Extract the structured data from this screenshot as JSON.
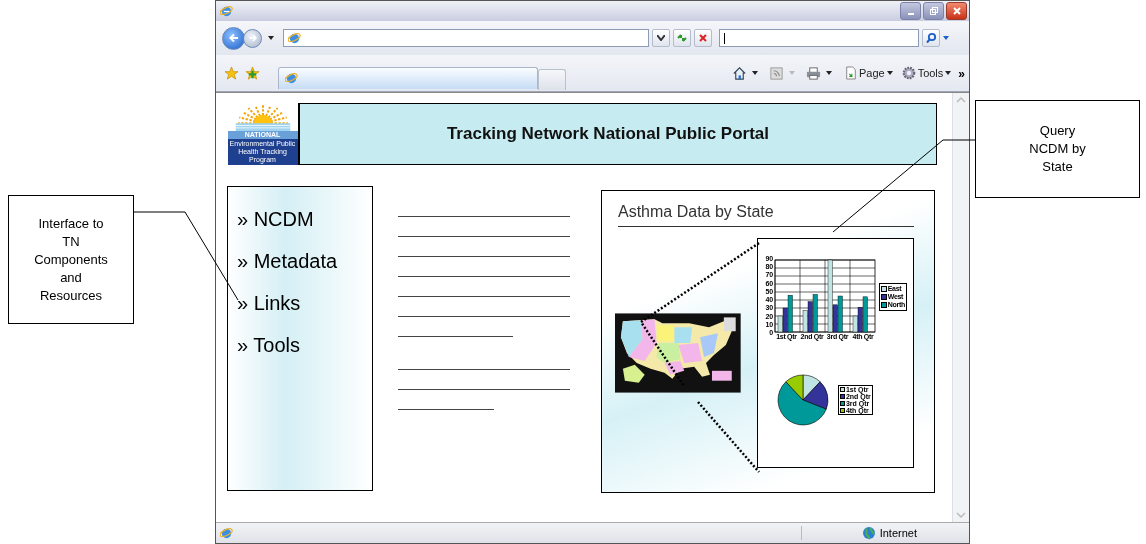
{
  "toolbar": {
    "page_menu": "Page",
    "tools_menu": "Tools",
    "chevron": "»"
  },
  "portal": {
    "logo_word": "NATIONAL",
    "logo_caption": "Environmental Public Health Tracking Program",
    "title": "Tracking Network National Public Portal",
    "nav": [
      {
        "label": "» NCDM"
      },
      {
        "label": "» Metadata"
      },
      {
        "label": "» Links"
      },
      {
        "label": "» Tools"
      }
    ],
    "panel": {
      "title": "Asthma Data by State",
      "chart_data": {
        "type": "bar",
        "categories": [
          "1st Qtr",
          "2nd Qtr",
          "3rd Qtr",
          "4th Qtr"
        ],
        "series": [
          {
            "name": "East",
            "color": "#c0e4e4",
            "values": [
              20,
              27,
              90,
              20
            ]
          },
          {
            "name": "West",
            "color": "#333399",
            "values": [
              30,
              38,
              34,
              31
            ]
          },
          {
            "name": "North",
            "color": "#009999",
            "values": [
              46,
              47,
              45,
              44
            ]
          }
        ],
        "ylim": [
          0,
          90
        ],
        "grid": true,
        "legend": "right",
        "yticks": [
          0,
          10,
          20,
          30,
          40,
          50,
          60,
          70,
          80,
          90
        ]
      },
      "pie_legend": [
        {
          "label": "1st Qtr",
          "color": "#c0e4e4"
        },
        {
          "label": "2nd Qtr",
          "color": "#333399"
        },
        {
          "label": "3rd Qtr",
          "color": "#009999"
        },
        {
          "label": "4th Qtr",
          "color": "#99cc00"
        }
      ]
    }
  },
  "status_bar": {
    "zone": "Internet"
  },
  "callouts": [
    {
      "text": "Interface to TN Components and Resources"
    },
    {
      "text": "Query NCDM by State"
    }
  ]
}
